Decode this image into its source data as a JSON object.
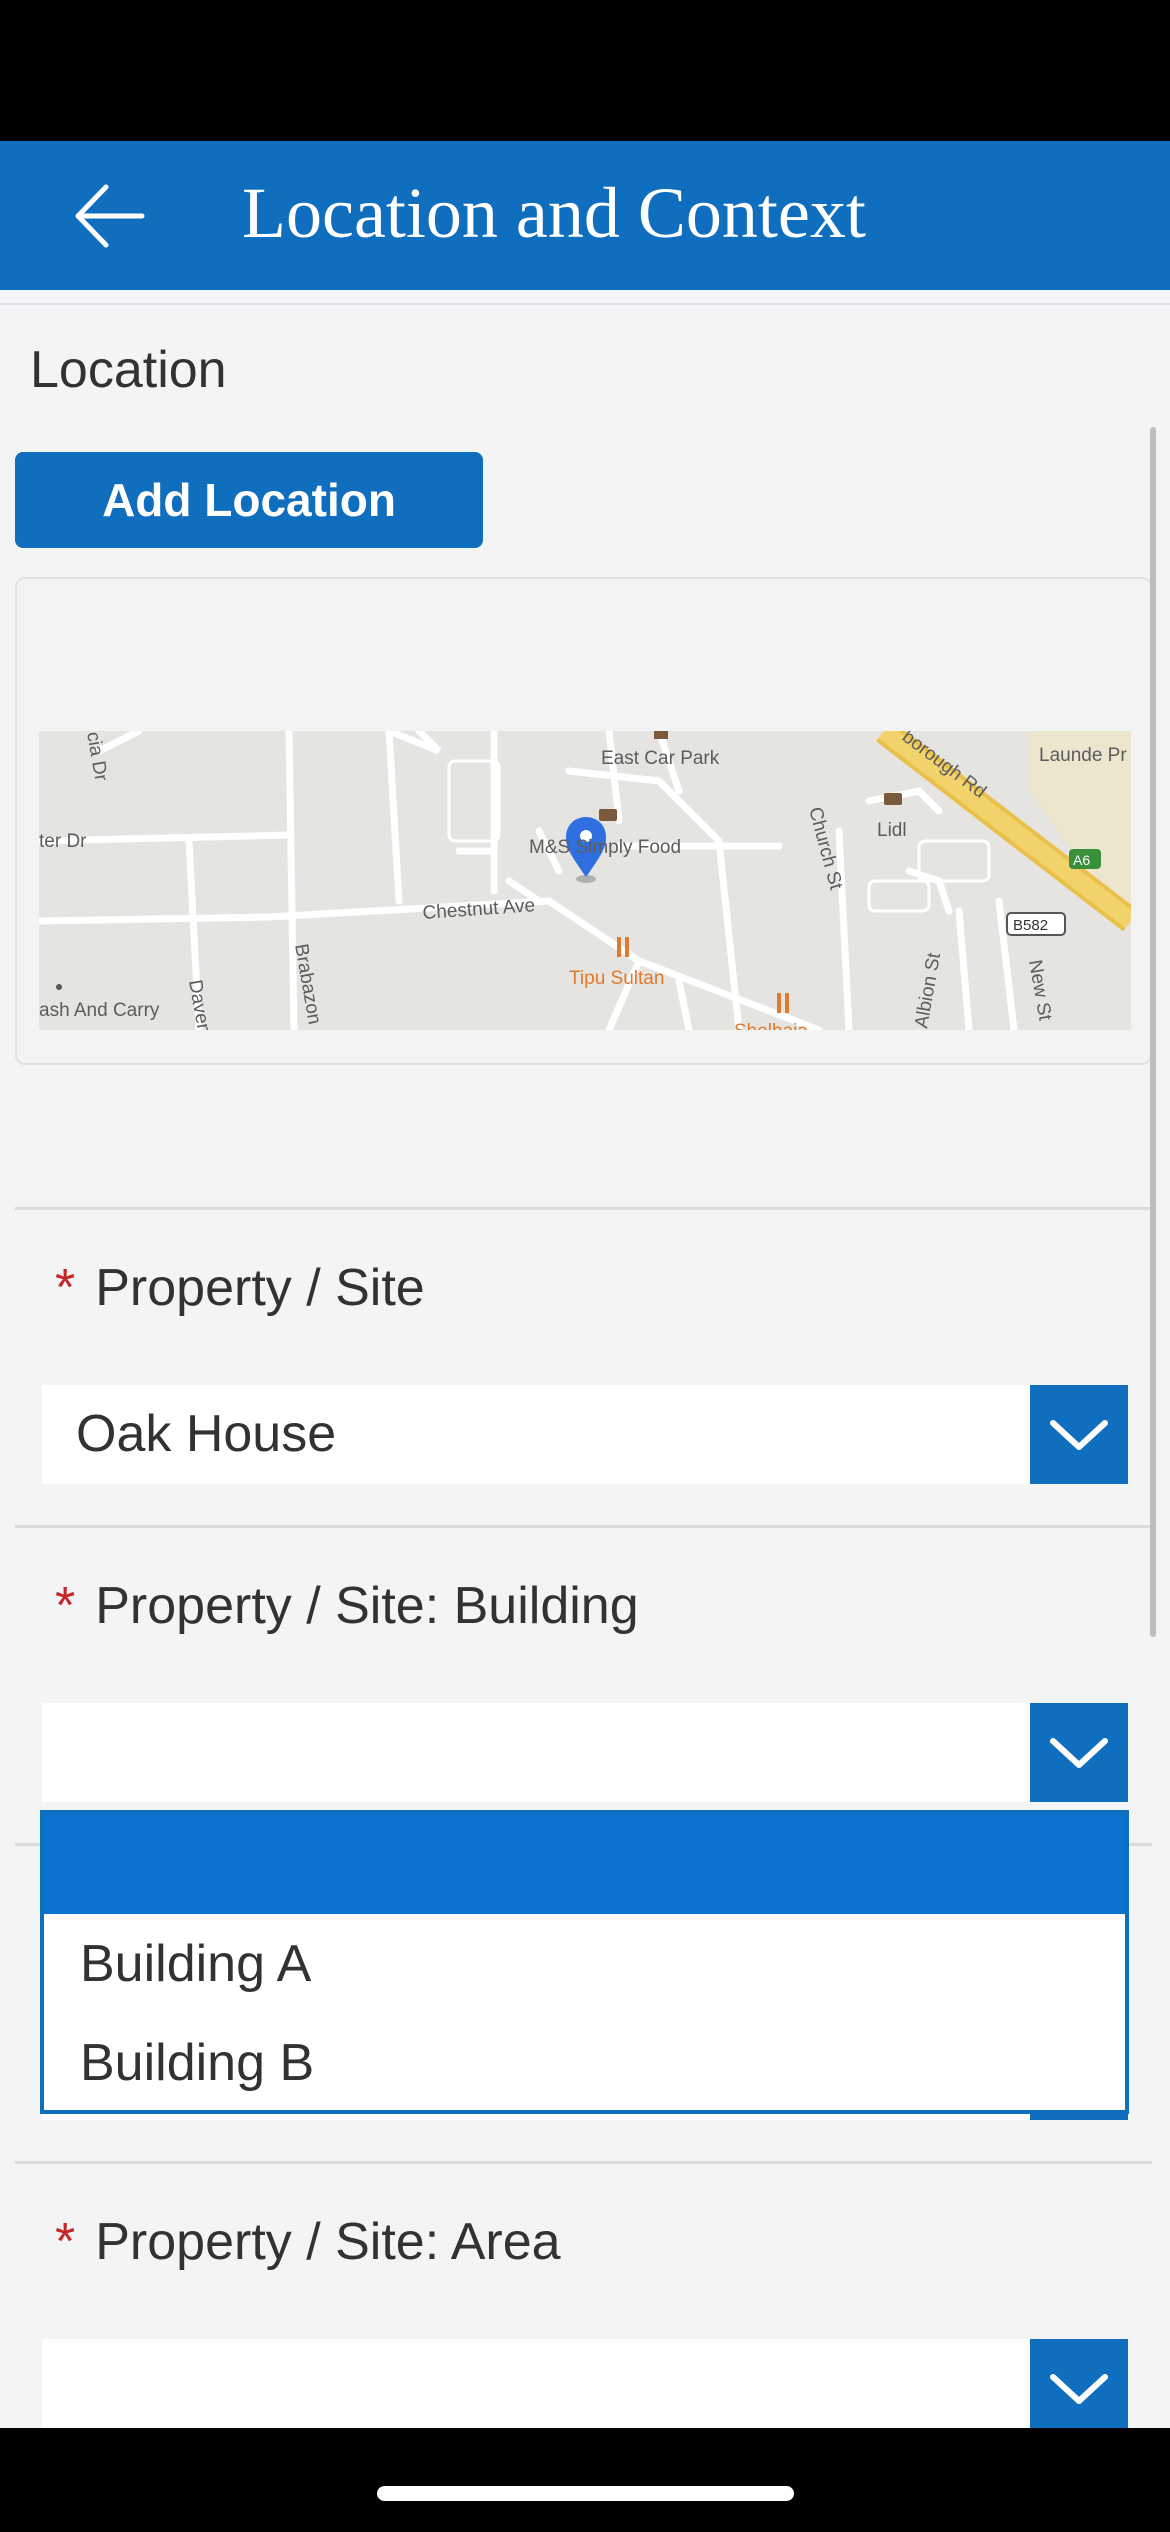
{
  "header": {
    "title": "Location and Context",
    "back_icon": "arrow-left-icon",
    "background_color": "#106ebe"
  },
  "location_section": {
    "label": "Location",
    "add_location_label": "Add Location"
  },
  "map": {
    "labels": {
      "east_car_park": "East Car Park",
      "ms_food": "M&S Simply Food",
      "lidl": "Lidl",
      "chestnut_ave": "Chestnut Ave",
      "tipu_sultan": "Tipu Sultan",
      "road_top_right": "borough Rd",
      "launde": "Launde Pr",
      "a6": "A6",
      "b582": "B582",
      "church_st": "Church St",
      "albion_st": "Albion St",
      "new_st": "New St",
      "brabazon": "Brabazon",
      "daven": "Daven",
      "cash_and_carry": "ash And Carry",
      "ter_dr": "ter Dr",
      "cia_dr": "cia Dr",
      "shelbaia": "Shelbaia"
    },
    "pin_icon": "location-pin-icon"
  },
  "fields": {
    "property_site": {
      "label": "Property / Site",
      "value": "Oak House"
    },
    "building": {
      "label": "Property / Site: Building",
      "value": "",
      "options": [
        "Building A",
        "Building B"
      ]
    },
    "area": {
      "label": "Property / Site: Area",
      "value": ""
    }
  },
  "required_marker": "*",
  "colors": {
    "accent": "#106ebe",
    "required": "#c62828",
    "selected_option": "#0a73d0",
    "background": "#f3f4f6"
  }
}
